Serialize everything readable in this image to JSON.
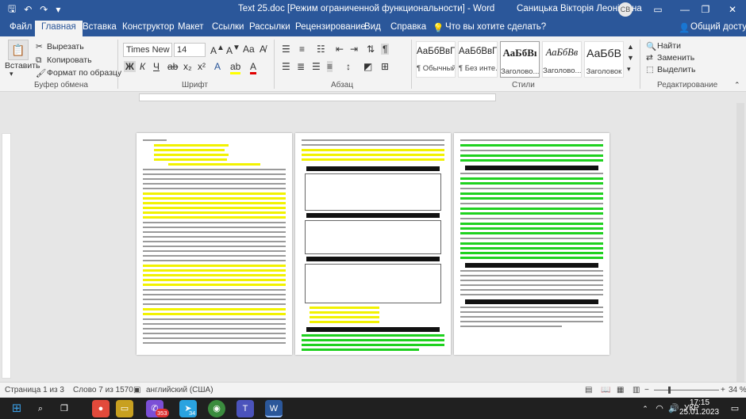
{
  "titlebar": {
    "document_title": "Text 25.doc [Режим ограниченной функциональности]  -  Word",
    "user_name": "Саницька Вікторія Леонідівна",
    "avatar_initials": "СВ",
    "save_icon": "save-icon",
    "undo_icon": "undo-icon",
    "redo_icon": "redo-icon",
    "minimize": "—",
    "restore": "❐",
    "close": "✕"
  },
  "tabs": [
    "Файл",
    "Главная",
    "Вставка",
    "Конструктор",
    "Макет",
    "Ссылки",
    "Рассылки",
    "Рецензирование",
    "Вид",
    "Справка"
  ],
  "tell_me": "Что вы хотите сделать?",
  "share": "Общий доступ",
  "clipboard": {
    "paste": "Вставить",
    "cut": "Вырезать",
    "copy": "Копировать",
    "format_painter": "Формат по образцу",
    "group": "Буфер обмена"
  },
  "font": {
    "name": "Times New Ro",
    "size": "14",
    "bold": "Ж",
    "italic": "К",
    "underline": "Ч",
    "group": "Шрифт"
  },
  "paragraph": {
    "group": "Абзац"
  },
  "styles": {
    "items": [
      {
        "preview": "АаБбВвГг,",
        "name": "¶ Обычный"
      },
      {
        "preview": "АаБбВвГг,",
        "name": "¶ Без инте..."
      },
      {
        "preview": "АаБбВı",
        "name": "Заголово..."
      },
      {
        "preview": "АаБбВв",
        "name": "Заголово..."
      },
      {
        "preview": "АаБбВ",
        "name": "Заголовок"
      }
    ],
    "group": "Стили"
  },
  "editing": {
    "find": "Найти",
    "replace": "Заменить",
    "select": "Выделить",
    "group": "Редактирование"
  },
  "status": {
    "page": "Страница 1 из 3",
    "words": "Слово 7 из 1570",
    "language": "английский (США)",
    "zoom": "34 %"
  },
  "taskbar": {
    "language": "УКР",
    "time": "17:15",
    "date": "25.01.2023",
    "badges": [
      "353",
      "34"
    ]
  },
  "accent": "#2b579a"
}
